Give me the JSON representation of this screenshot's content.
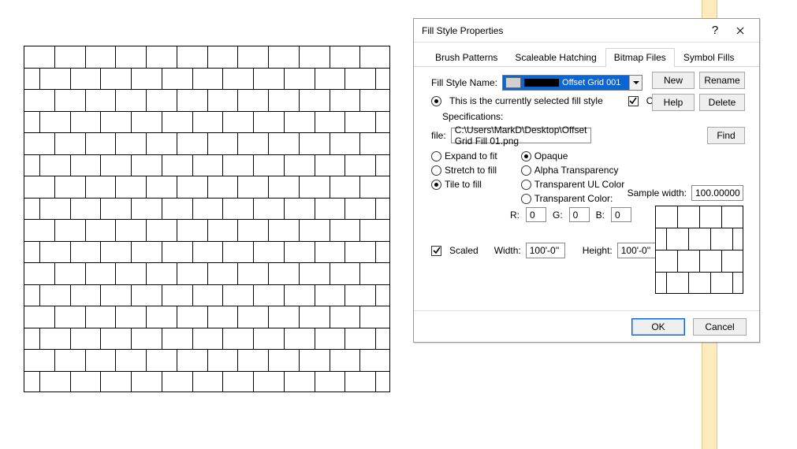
{
  "dialog": {
    "title": "Fill Style Properties",
    "tabs": [
      "Brush Patterns",
      "Scaleable Hatching",
      "Bitmap Files",
      "Symbol Fills"
    ],
    "active_tab_index": 2,
    "fsn_label": "Fill Style Name:",
    "fsn_value": "Offset Grid 001",
    "buttons": {
      "new": "New",
      "rename": "Rename",
      "help": "Help",
      "delete": "Delete",
      "find": "Find"
    },
    "selected_note": "This is the currently selected fill style",
    "outlined_label": "Outlined",
    "outlined_checked": true,
    "spec_label": "Specifications:",
    "file_label": "file:",
    "file_value": "C:\\Users\\MarkD\\Desktop\\Offset Grid Fill 01.png",
    "fit_options": {
      "expand": "Expand to fit",
      "stretch": "Stretch to fill",
      "tile": "Tile to fill",
      "selected": "tile"
    },
    "trans_options": {
      "opaque": "Opaque",
      "alpha": "Alpha Transparency",
      "ul": "Transparent UL Color",
      "color": "Transparent Color:",
      "selected": "opaque"
    },
    "rgb": {
      "r_label": "R:",
      "r": "0",
      "g_label": "G:",
      "g": "0",
      "b_label": "B:",
      "b": "0"
    },
    "sample_width_label": "Sample width:",
    "sample_width": "100.00000",
    "scaled_label": "Scaled",
    "scaled_checked": true,
    "width_label": "Width:",
    "width": "100'-0''",
    "height_label": "Height:",
    "height": "100'-0''",
    "footer": {
      "ok": "OK",
      "cancel": "Cancel"
    }
  }
}
